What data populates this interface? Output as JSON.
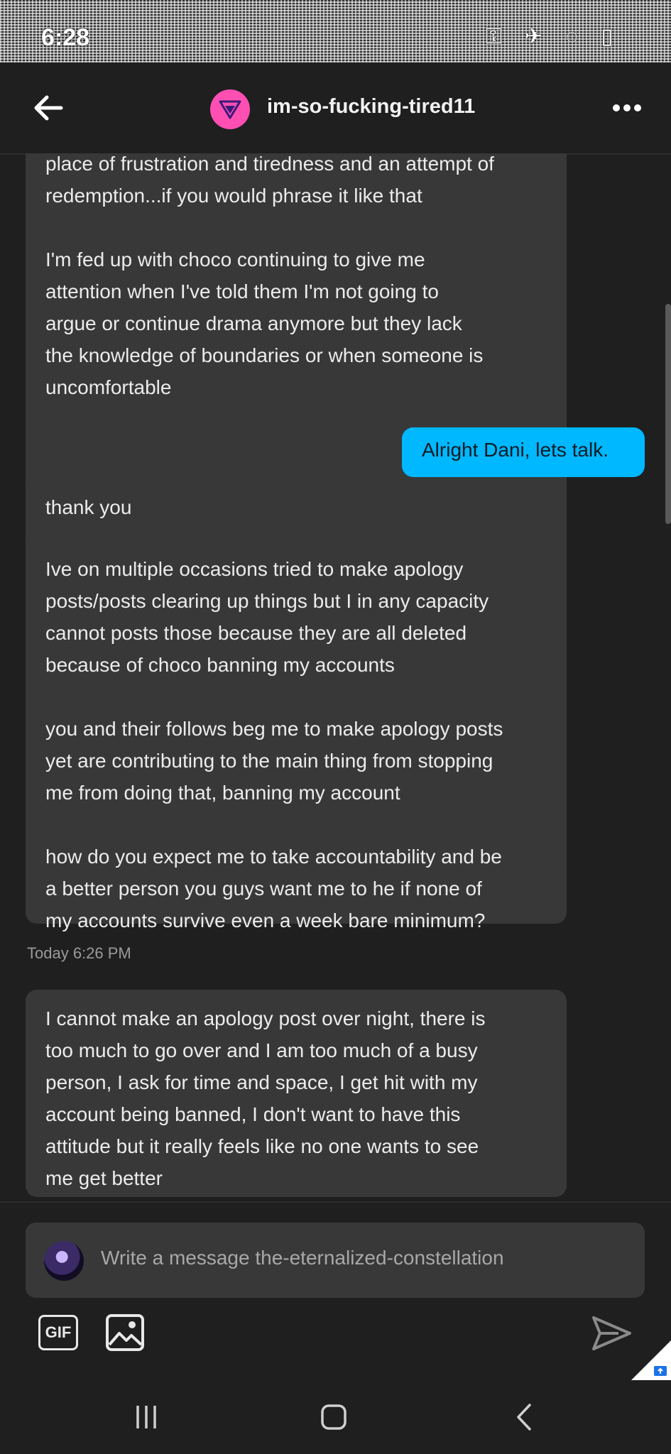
{
  "status_bar": {
    "time": "6:28",
    "icons_text": "⚿ ✈ ◌ ▯"
  },
  "header": {
    "blog_name": "im-so-fucking-tired11",
    "avatar_icon": "triangle-logo-icon",
    "more_label": "•••"
  },
  "messages": [
    {
      "from": "them",
      "text": "place of frustration and tiredness and an attempt of\nredemption...if you would phrase it like that\n\n I'm fed up with choco continuing to give me\nattention when I've told them I'm not going to\nargue or continue drama anymore but they lack\nthe knowledge of boundaries or when someone is\nuncomfortable"
    },
    {
      "from": "me",
      "text": "Alright Dani, lets talk."
    },
    {
      "from": "them",
      "text": "thank you"
    },
    {
      "from": "them",
      "text": "Ive on multiple occasions tried to make apology\nposts/posts clearing up things but I in any capacity\ncannot posts those because they are all deleted\nbecause of choco banning my accounts\n\nyou and their follows beg me to make apology posts\nyet are contributing to the main thing from stopping\nme from doing that, banning my account\n\nhow do you expect me to take accountability and be\na better person you guys want me to he if none of\nmy accounts survive even a week bare minimum?"
    },
    {
      "from": "them",
      "text": "I cannot make an apology post over night, there is\ntoo much to go over and I am too much of a busy\nperson, I ask for time and space, I get hit with my\naccount being banned, I don't want to have this\nattitude but it really feels like no one wants to see\nme get better"
    }
  ],
  "timestamp": "Today 6:26 PM",
  "composer": {
    "placeholder": "Write a message the-eternalized-constellation"
  },
  "tools": {
    "gif_label": "GIF"
  },
  "colors": {
    "background": "#1f1f1f",
    "bubble_them": "#383838",
    "bubble_me": "#00b8ff",
    "accent_avatar": "#ff4fb3"
  }
}
